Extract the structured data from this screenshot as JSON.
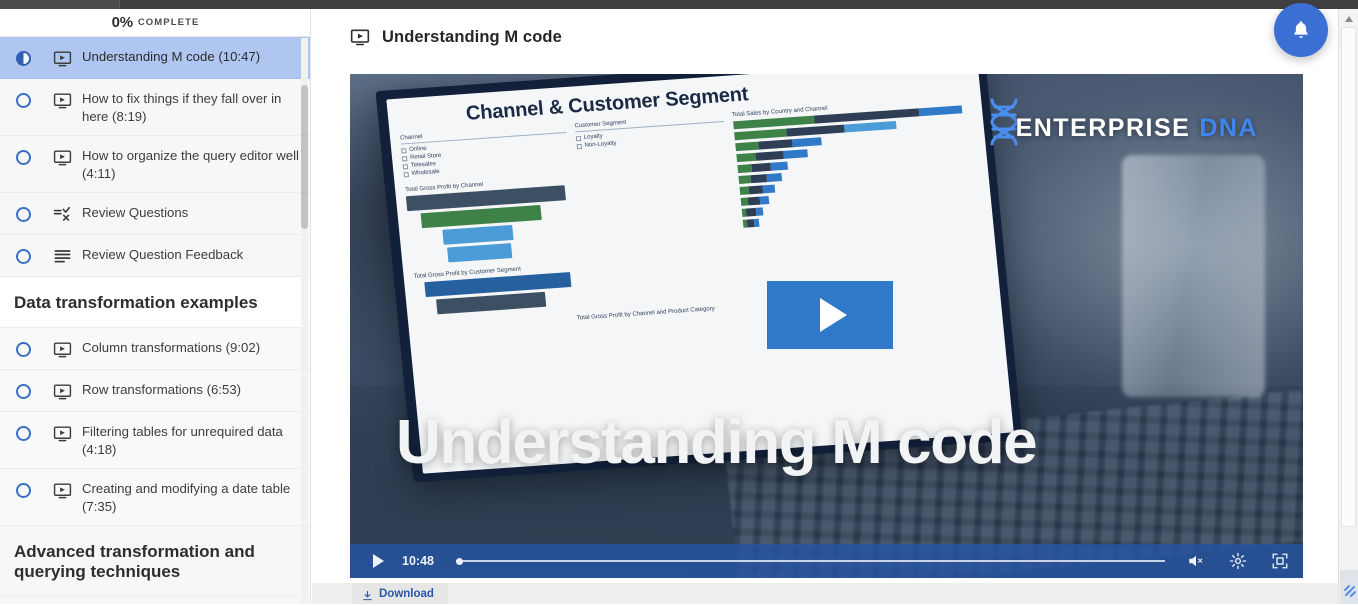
{
  "sidebar": {
    "progress": {
      "percent": "0%",
      "label": "COMPLETE"
    },
    "items": [
      {
        "label": "Understanding M code (10:47)",
        "icon": "video-icon",
        "status": "half",
        "active": true
      },
      {
        "label": "How to fix things if they fall over in here (8:19)",
        "icon": "video-icon",
        "status": "empty",
        "active": false
      },
      {
        "label": "How to organize the query editor well (4:11)",
        "icon": "video-icon",
        "status": "empty",
        "active": false
      },
      {
        "label": "Review Questions",
        "icon": "quiz-icon",
        "status": "empty",
        "active": false
      },
      {
        "label": "Review Question Feedback",
        "icon": "text-lines-icon",
        "status": "empty",
        "active": false
      }
    ],
    "section_one": "Data transformation examples",
    "section_one_items": [
      {
        "label": "Column transformations (9:02)",
        "icon": "video-icon",
        "status": "empty"
      },
      {
        "label": "Row transformations (6:53)",
        "icon": "video-icon",
        "status": "empty"
      },
      {
        "label": "Filtering tables for unrequired data (4:18)",
        "icon": "video-icon",
        "status": "empty"
      },
      {
        "label": "Creating and modifying a date table (7:35)",
        "icon": "video-icon",
        "status": "empty"
      }
    ],
    "section_two": "Advanced transformation and querying techniques"
  },
  "main": {
    "lesson_title": "Understanding M code",
    "lesson_title_icon": "video-icon"
  },
  "video": {
    "headline": "Understanding M code",
    "brand_primary": "ENTERPRISE",
    "brand_secondary": "DNA",
    "play_button": "play-button",
    "dashboard": {
      "title": "Channel & Customer Segment",
      "slicer_channel_label": "Channel",
      "slicer_channel_options": [
        "Online",
        "Retail Store",
        "Telesales",
        "Wholesale"
      ],
      "slicer_segment_label": "Customer Segment",
      "slicer_segment_options": [
        "Loyalty",
        "Non-Loyalty"
      ],
      "chart_profit_channel": "Total Gross Profit by Channel",
      "chart_profit_segment": "Total Gross Profit by Customer Segment",
      "chart_sales_country": "Total Sales by Country and Channel",
      "chart_bottom": "Total Gross Profit by Channel and Product Category"
    },
    "controls": {
      "play_icon": "play-icon",
      "time": "10:48",
      "volume_icon": "volume-mute-icon",
      "settings_icon": "gear-icon",
      "fullscreen_icon": "fullscreen-icon"
    }
  },
  "download": {
    "label": "Download",
    "icon": "download-icon"
  },
  "notifications": {
    "icon": "bell-icon"
  },
  "colors": {
    "accent_blue": "#3b6fd4",
    "controls_blue": "#2655a3",
    "active_item": "#aec6f0",
    "link_blue": "#2a57a8",
    "topbar_dark": "#414141"
  }
}
